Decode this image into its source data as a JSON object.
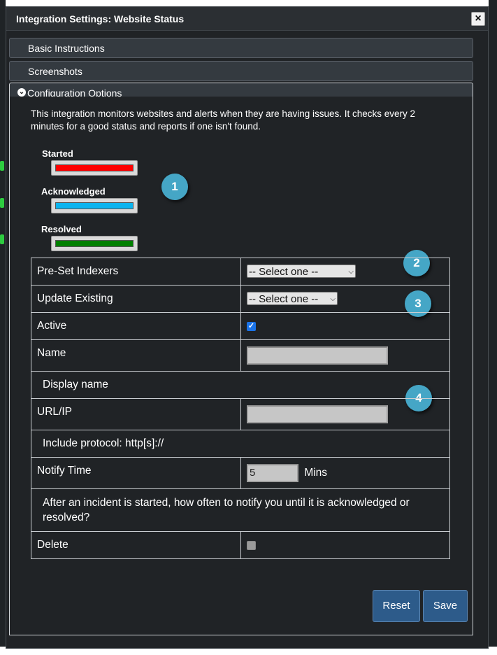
{
  "modal": {
    "title": "Integration Settings: Website Status",
    "close_glyph": "×"
  },
  "accordion": [
    {
      "label": "Basic Instructions"
    },
    {
      "label": "Screenshots"
    },
    {
      "label": "Configuration Options"
    }
  ],
  "intro_text": "This integration monitors websites and alerts when they are having issues. It checks every 2 minutes for a good status and reports if one isn't found.",
  "legend": [
    {
      "label": "Started",
      "color": "#ff0000"
    },
    {
      "label": "Acknowledged",
      "color": "#0ab4ef"
    },
    {
      "label": "Resolved",
      "color": "#008000"
    }
  ],
  "badges": [
    "1",
    "2",
    "3",
    "4"
  ],
  "form": {
    "preset_label": "Pre-Set Indexers",
    "preset_value": "-- Select one --",
    "update_label": "Update Existing",
    "update_value": "-- Select one --",
    "active_label": "Active",
    "active_checked": true,
    "name_label": "Name",
    "name_value": "",
    "name_help": "Display name",
    "url_label": "URL/IP",
    "url_value": "",
    "url_help": "Include protocol: http[s]://",
    "notify_label": "Notify Time",
    "notify_value": "5",
    "notify_unit": "Mins",
    "notify_help": "After an incident is started, how often to notify you until it is acknowledged or resolved?",
    "delete_label": "Delete",
    "delete_checked": false
  },
  "buttons": {
    "reset": "Reset",
    "save": "Save"
  },
  "colors": {
    "modal_bg": "#202326",
    "accent_button": "#2d5b8a",
    "badge": "#45a6c6"
  }
}
